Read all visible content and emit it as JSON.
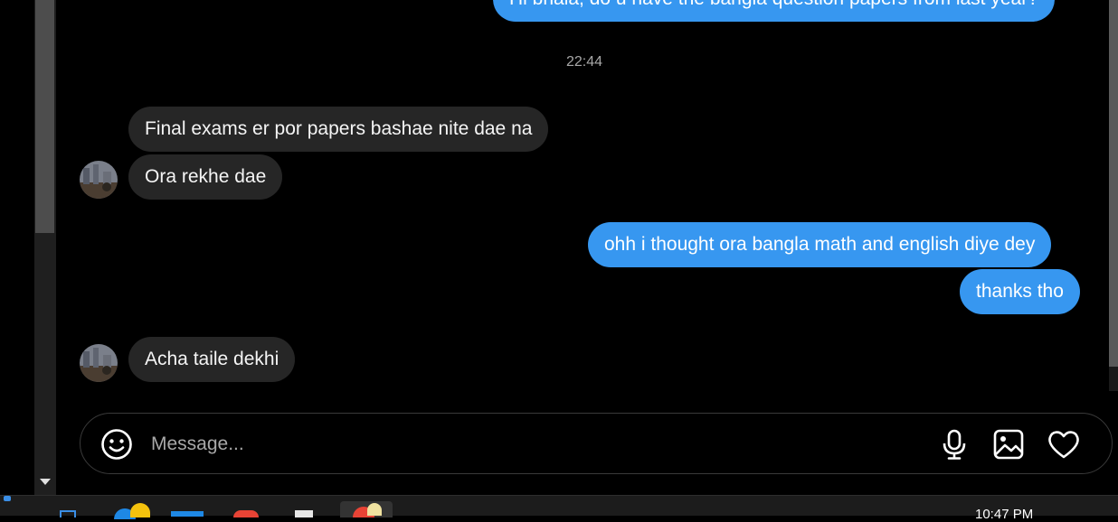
{
  "messages": {
    "sent_top": "Hi bhaia, do u have the bangla question papers from last year?",
    "timestamp": "22:44",
    "recv_1": "Final exams er por papers bashae nite dae na",
    "recv_2": "Ora rekhe dae",
    "sent_1": "ohh i thought ora bangla math and english diye dey",
    "sent_2": "thanks tho",
    "recv_3": "Acha taile dekhi"
  },
  "composer": {
    "placeholder": "Message..."
  },
  "icons": {
    "emoji": "smiley-icon",
    "voice": "microphone-icon",
    "media": "image-icon",
    "like": "heart-icon"
  },
  "colors": {
    "sent_bubble": "#3797f0",
    "received_bubble": "#262626",
    "background": "#000000"
  },
  "taskbar": {
    "clock": "10:47 PM"
  }
}
